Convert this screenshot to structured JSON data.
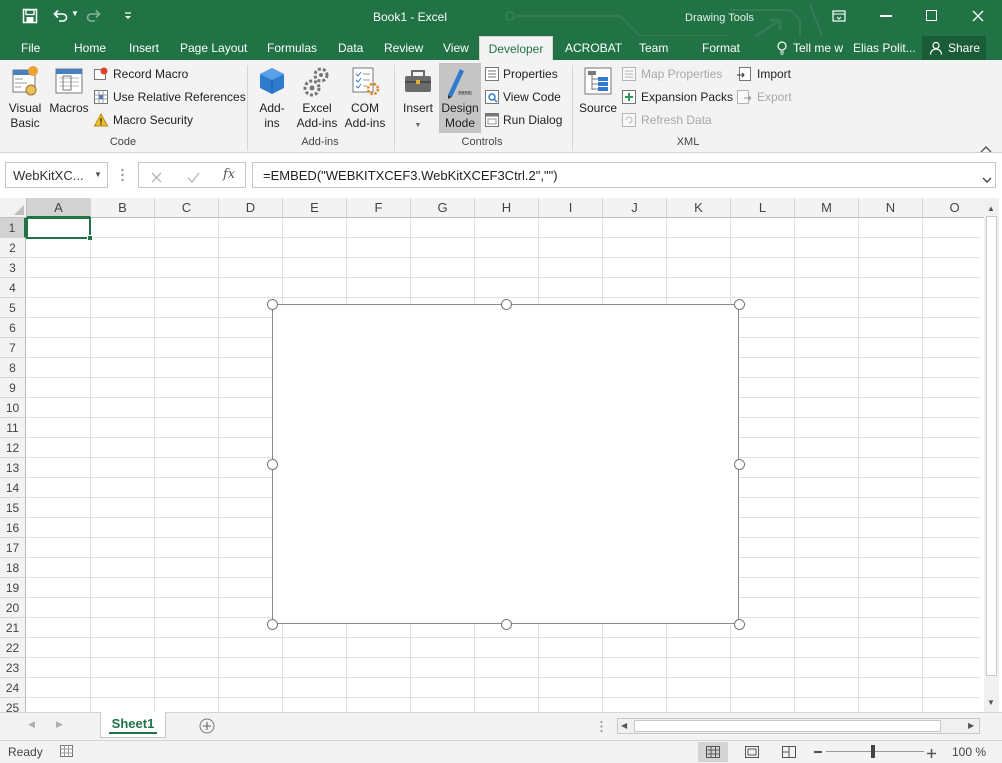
{
  "window": {
    "title": "Book1 - Excel",
    "context_tab_group": "Drawing Tools",
    "accent": "#217346"
  },
  "tabs": [
    {
      "label": "File"
    },
    {
      "label": "Home"
    },
    {
      "label": "Insert"
    },
    {
      "label": "Page Layout"
    },
    {
      "label": "Formulas"
    },
    {
      "label": "Data"
    },
    {
      "label": "Review"
    },
    {
      "label": "View"
    },
    {
      "label": "Developer",
      "active": true
    },
    {
      "label": "ACROBAT"
    },
    {
      "label": "Team"
    },
    {
      "label": "Format"
    }
  ],
  "tell_me": "Tell me w",
  "user": "Elias Polit...",
  "share": "Share",
  "ribbon": {
    "code": {
      "label": "Code",
      "visual_basic": "Visual Basic",
      "macros": "Macros",
      "record_macro": "Record Macro",
      "use_relative": "Use Relative References",
      "macro_security": "Macro Security"
    },
    "addins": {
      "label": "Add-ins",
      "add_ins": "Add-ins",
      "excel_addins": "Excel Add-ins",
      "com_addins": "COM Add-ins"
    },
    "controls": {
      "label": "Controls",
      "insert": "Insert",
      "design_mode": "Design Mode",
      "properties": "Properties",
      "view_code": "View Code",
      "run_dialog": "Run Dialog"
    },
    "xml": {
      "label": "XML",
      "source": "Source",
      "map_properties": "Map Properties",
      "expansion_packs": "Expansion Packs",
      "refresh_data": "Refresh Data",
      "import": "Import",
      "export": "Export"
    }
  },
  "formula_bar": {
    "name_box": "WebKitXC...",
    "fx": "fx",
    "formula": "=EMBED(\"WEBKITXCEF3.WebKitXCEF3Ctrl.2\",\"\")"
  },
  "grid": {
    "columns": [
      "A",
      "B",
      "C",
      "D",
      "E",
      "F",
      "G",
      "H",
      "I",
      "J",
      "K",
      "L",
      "M",
      "N",
      "O"
    ],
    "rows": [
      "1",
      "2",
      "3",
      "4",
      "5",
      "6",
      "7",
      "8",
      "9",
      "10",
      "11",
      "12",
      "13",
      "14",
      "15",
      "16",
      "17",
      "18",
      "19",
      "20",
      "21",
      "22",
      "23",
      "24",
      "25"
    ],
    "selected_cell": "A1"
  },
  "sheets": [
    {
      "name": "Sheet1",
      "active": true
    }
  ],
  "status": {
    "ready": "Ready",
    "zoom": "100 %"
  }
}
